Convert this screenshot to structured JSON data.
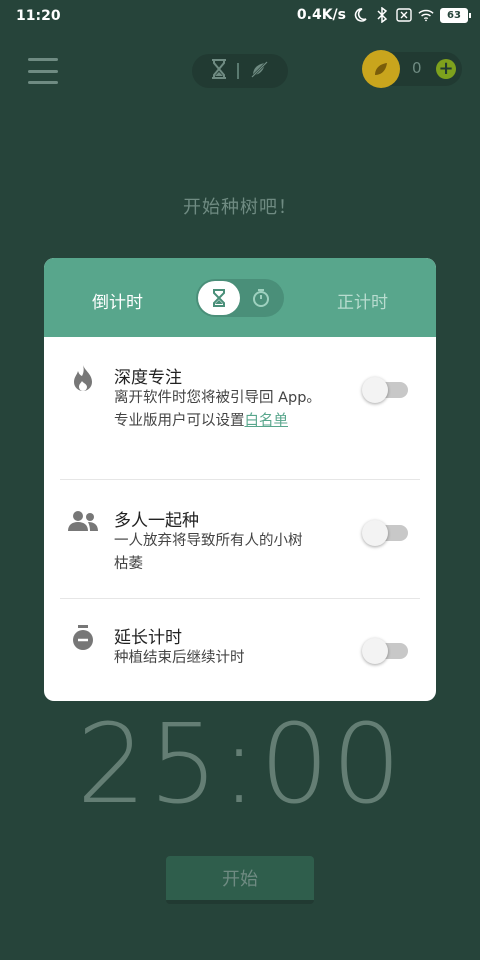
{
  "status_bar": {
    "time": "11:20",
    "net_speed": "0.4K/s",
    "battery": "63"
  },
  "header": {
    "coin_count": "0",
    "add_symbol": "+"
  },
  "prompt": "开始种树吧！",
  "card": {
    "tab_countdown": "倒计时",
    "tab_countup": "正计时",
    "options": [
      {
        "title": "深度专注",
        "desc_line1": "离开软件时您将被引导回 App。",
        "desc_line2": "专业版用户可以设置",
        "desc_link": "白名单",
        "enabled": false
      },
      {
        "title": "多人一起种",
        "desc_line1": "一人放弃将导致所有人的小树",
        "desc_line2": "枯萎",
        "enabled": false
      },
      {
        "title": "延长计时",
        "desc_line1": "种植结束后继续计时",
        "enabled": false
      }
    ]
  },
  "timer": "25:00",
  "start_button": "开始",
  "colors": {
    "background": "#26443a",
    "card_header": "#58a68c",
    "coin": "#c9a51d"
  }
}
